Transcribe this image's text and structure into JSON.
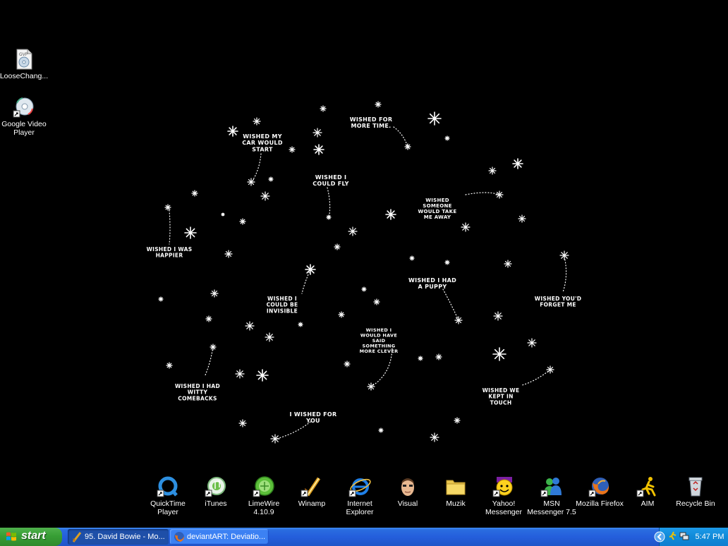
{
  "desktop_icons_left": [
    {
      "label": "LooseChang...",
      "icon": "video-file-icon"
    },
    {
      "label": "Google Video Player",
      "icon": "google-video-icon"
    }
  ],
  "wallpaper_wishes": [
    "WISHED MY CAR WOULD START",
    "WISHED FOR MORE TIME.",
    "WISHED I COULD FLY",
    "WISHED SOMEONE WOULD TAKE ME AWAY",
    "WISHED I WAS HAPPIER",
    "WISHED I COULD BE INVISIBLE",
    "WISHED I HAD A PUPPY",
    "WISHED YOU'D FORGET ME",
    "WISHED I WOULD HAVE SAID SOMETHING MORE CLEVER",
    "WISHED I HAD WITTY COMEBACKS",
    "WISHED WE KEPT IN TOUCH",
    "I WISHED FOR YOU"
  ],
  "dock_icons": [
    {
      "label": "QuickTime Player",
      "icon": "quicktime-icon"
    },
    {
      "label": "iTunes",
      "icon": "itunes-icon"
    },
    {
      "label": "LimeWire 4.10.9",
      "icon": "limewire-icon"
    },
    {
      "label": "Winamp",
      "icon": "winamp-icon"
    },
    {
      "label": "Internet Explorer",
      "icon": "internet-explorer-icon"
    },
    {
      "label": "Visual",
      "icon": "visual-icon"
    },
    {
      "label": "Muzik",
      "icon": "folder-icon"
    },
    {
      "label": "Yahoo! Messenger",
      "icon": "yahoo-messenger-icon"
    },
    {
      "label": "MSN Messenger 7.5",
      "icon": "msn-messenger-icon"
    },
    {
      "label": "Mozilla Firefox",
      "icon": "firefox-icon"
    },
    {
      "label": "AIM",
      "icon": "aim-icon"
    },
    {
      "label": "Recycle Bin",
      "icon": "recycle-bin-icon"
    }
  ],
  "taskbar": {
    "start_label": "start",
    "tasks": [
      {
        "label": "95. David Bowie - Mo...",
        "active": true
      },
      {
        "label": "deviantART: Deviatio...",
        "active": false
      }
    ],
    "clock": "5:47 PM"
  },
  "colors": {
    "taskbar_blue": "#245edc",
    "start_green": "#379e35",
    "tray_blue": "#108ad8"
  }
}
